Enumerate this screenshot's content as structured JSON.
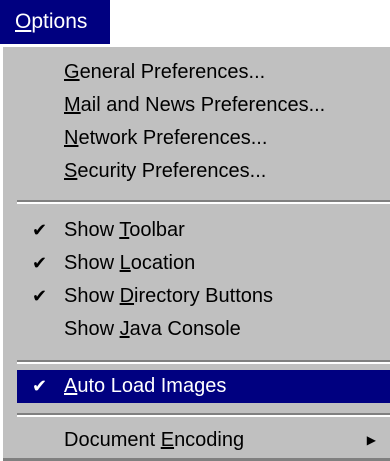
{
  "menu": {
    "title": {
      "mnemonic": "O",
      "rest": "ptions"
    },
    "sections": [
      {
        "items": [
          {
            "mnemonic": "G",
            "rest": "eneral Preferences...",
            "checked": false
          },
          {
            "mnemonic": "M",
            "rest": "ail and News Preferences...",
            "checked": false
          },
          {
            "mnemonic": "N",
            "rest": "etwork Preferences...",
            "checked": false
          },
          {
            "mnemonic": "S",
            "rest": "ecurity Preferences...",
            "checked": false
          }
        ]
      },
      {
        "items": [
          {
            "prefix": "Show ",
            "mnemonic": "T",
            "rest": "oolbar",
            "checked": true
          },
          {
            "prefix": "Show ",
            "mnemonic": "L",
            "rest": "ocation",
            "checked": true
          },
          {
            "prefix": "Show ",
            "mnemonic": "D",
            "rest": "irectory Buttons",
            "checked": true
          },
          {
            "prefix": "Show ",
            "mnemonic": "J",
            "rest": "ava Console",
            "checked": false
          }
        ]
      },
      {
        "items": [
          {
            "mnemonic": "A",
            "rest": "uto Load Images",
            "checked": true,
            "selected": true
          }
        ]
      },
      {
        "items": [
          {
            "prefix": "Document ",
            "mnemonic": "E",
            "rest": "ncoding",
            "checked": false,
            "submenu": true
          }
        ]
      }
    ],
    "check_glyph": "✔",
    "submenu_glyph": "▶",
    "colors": {
      "highlight": "#000080",
      "face": "#c0c0c0",
      "highlight_text": "#ffffff"
    }
  }
}
